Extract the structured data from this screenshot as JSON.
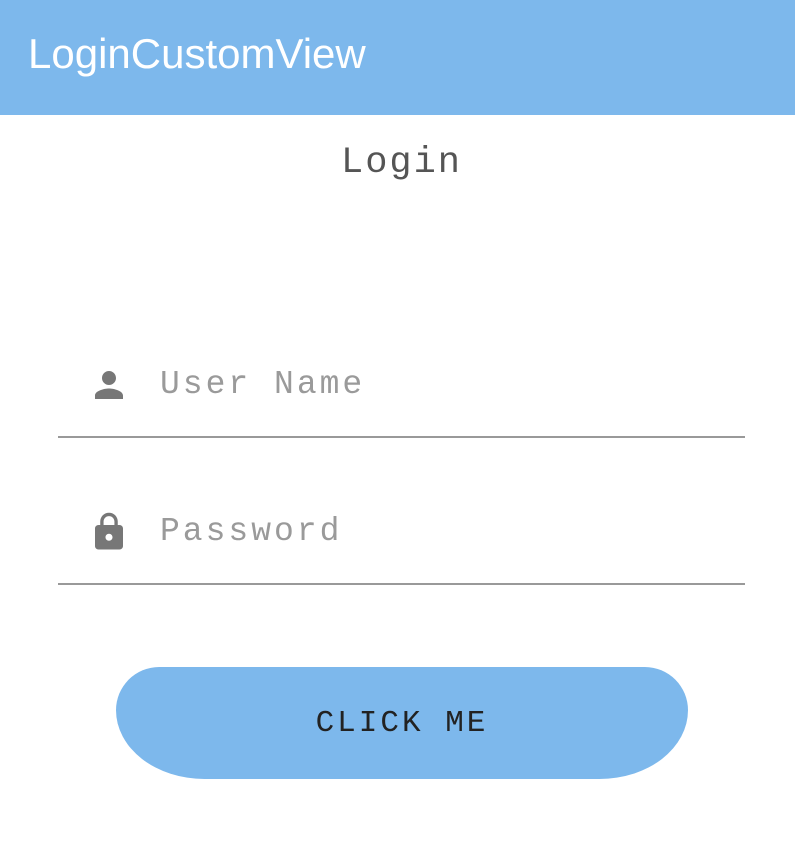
{
  "app_bar": {
    "title": "LoginCustomView"
  },
  "form": {
    "heading": "Login",
    "username": {
      "placeholder": "User Name",
      "value": "",
      "icon": "person-icon"
    },
    "password": {
      "placeholder": "Password",
      "value": "",
      "icon": "lock-icon"
    },
    "submit_label": "CLICK ME"
  },
  "colors": {
    "accent": "#7db8ec",
    "icon": "#777777",
    "underline": "#999999"
  }
}
